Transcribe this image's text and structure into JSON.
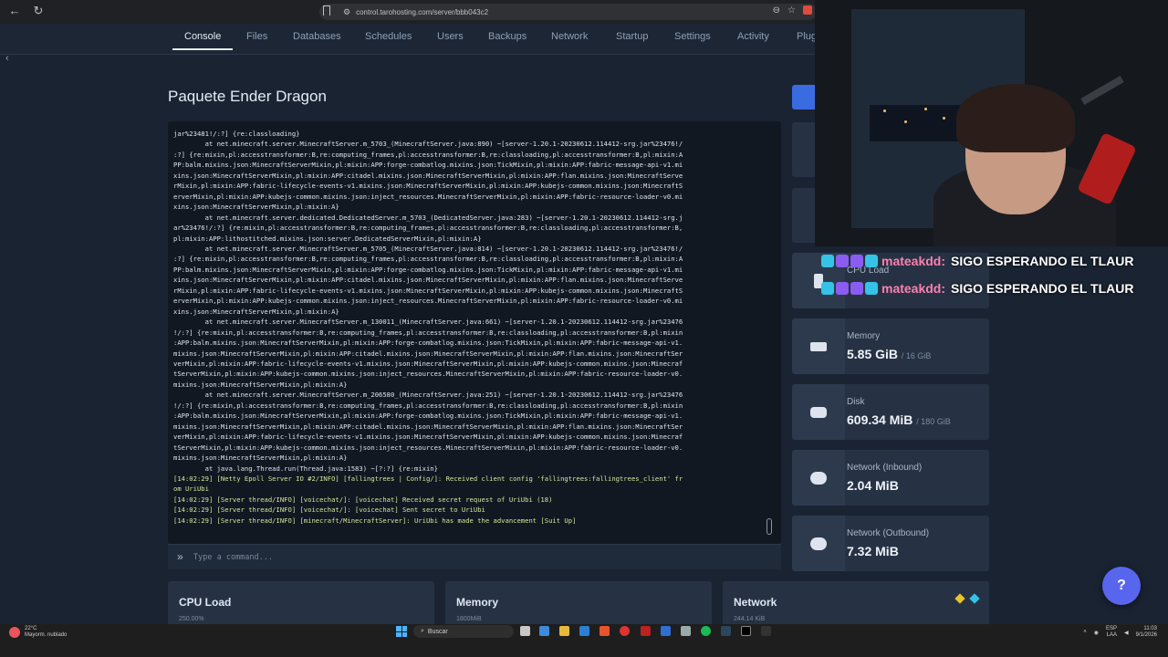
{
  "browser": {
    "url": "control.tarohosting.com/server/bbb043c2",
    "back_icon": "arrow-left-icon",
    "reload_icon": "reload-icon"
  },
  "nav": {
    "tabs": [
      "Console",
      "Files",
      "Databases",
      "Schedules",
      "Users",
      "Backups",
      "Network",
      "Startup",
      "Settings",
      "Activity",
      "Plug"
    ],
    "active_tab": "Console"
  },
  "server": {
    "title": "Paquete Ender Dragon"
  },
  "console": {
    "lines": [
      {
        "text": "jar%23481!/:?] {re:classloading}",
        "kind": "trace"
      },
      {
        "text": "        at net.minecraft.server.MinecraftServer.m_5703_(MinecraftServer.java:890) ~[server-1.20.1-20230612.114412-srg.jar%23476!/",
        "kind": "trace"
      },
      {
        "text": ":?] {re:mixin,pl:accesstransformer:B,re:computing_frames,pl:accesstransformer:B,re:classloading,pl:accesstransformer:B,pl:mixin:A",
        "kind": "trace"
      },
      {
        "text": "PP:balm.mixins.json:MinecraftServerMixin,pl:mixin:APP:forge-combatlog.mixins.json:TickMixin,pl:mixin:APP:fabric-message-api-v1.mi",
        "kind": "trace"
      },
      {
        "text": "xins.json:MinecraftServerMixin,pl:mixin:APP:citadel.mixins.json:MinecraftServerMixin,pl:mixin:APP:flan.mixins.json:MinecraftServe",
        "kind": "trace"
      },
      {
        "text": "rMixin,pl:mixin:APP:fabric-lifecycle-events-v1.mixins.json:MinecraftServerMixin,pl:mixin:APP:kubejs-common.mixins.json:MinecraftS",
        "kind": "trace"
      },
      {
        "text": "erverMixin,pl:mixin:APP:kubejs-common.mixins.json:inject_resources.MinecraftServerMixin,pl:mixin:APP:fabric-resource-loader-v0.mi",
        "kind": "trace"
      },
      {
        "text": "xins.json:MinecraftServerMixin,pl:mixin:A}",
        "kind": "trace"
      },
      {
        "text": "        at net.minecraft.server.dedicated.DedicatedServer.m_5703_(DedicatedServer.java:283) ~[server-1.20.1-20230612.114412-srg.j",
        "kind": "trace"
      },
      {
        "text": "ar%23476!/:?] {re:mixin,pl:accesstransformer:B,re:computing_frames,pl:accesstransformer:B,re:classloading,pl:accesstransformer:B,",
        "kind": "trace"
      },
      {
        "text": "pl:mixin:APP:lithostitched.mixins.json:server.DedicatedServerMixin,pl:mixin:A}",
        "kind": "trace"
      },
      {
        "text": "        at net.minecraft.server.MinecraftServer.m_5705_(MinecraftServer.java:814) ~[server-1.20.1-20230612.114412-srg.jar%23476!/",
        "kind": "trace"
      },
      {
        "text": ":?] {re:mixin,pl:accesstransformer:B,re:computing_frames,pl:accesstransformer:B,re:classloading,pl:accesstransformer:B,pl:mixin:A",
        "kind": "trace"
      },
      {
        "text": "PP:balm.mixins.json:MinecraftServerMixin,pl:mixin:APP:forge-combatlog.mixins.json:TickMixin,pl:mixin:APP:fabric-message-api-v1.mi",
        "kind": "trace"
      },
      {
        "text": "xins.json:MinecraftServerMixin,pl:mixin:APP:citadel.mixins.json:MinecraftServerMixin,pl:mixin:APP:flan.mixins.json:MinecraftServe",
        "kind": "trace"
      },
      {
        "text": "rMixin,pl:mixin:APP:fabric-lifecycle-events-v1.mixins.json:MinecraftServerMixin,pl:mixin:APP:kubejs-common.mixins.json:MinecraftS",
        "kind": "trace"
      },
      {
        "text": "erverMixin,pl:mixin:APP:kubejs-common.mixins.json:inject_resources.MinecraftServerMixin,pl:mixin:APP:fabric-resource-loader-v0.mi",
        "kind": "trace"
      },
      {
        "text": "xins.json:MinecraftServerMixin,pl:mixin:A}",
        "kind": "trace"
      },
      {
        "text": "        at net.minecraft.server.MinecraftServer.m_130011_(MinecraftServer.java:661) ~[server-1.20.1-20230612.114412-srg.jar%23476",
        "kind": "trace"
      },
      {
        "text": "!/:?] {re:mixin,pl:accesstransformer:B,re:computing_frames,pl:accesstransformer:B,re:classloading,pl:accesstransformer:B,pl:mixin",
        "kind": "trace"
      },
      {
        "text": ":APP:balm.mixins.json:MinecraftServerMixin,pl:mixin:APP:forge-combatlog.mixins.json:TickMixin,pl:mixin:APP:fabric-message-api-v1.",
        "kind": "trace"
      },
      {
        "text": "mixins.json:MinecraftServerMixin,pl:mixin:APP:citadel.mixins.json:MinecraftServerMixin,pl:mixin:APP:flan.mixins.json:MinecraftSer",
        "kind": "trace"
      },
      {
        "text": "verMixin,pl:mixin:APP:fabric-lifecycle-events-v1.mixins.json:MinecraftServerMixin,pl:mixin:APP:kubejs-common.mixins.json:Minecraf",
        "kind": "trace"
      },
      {
        "text": "tServerMixin,pl:mixin:APP:kubejs-common.mixins.json:inject_resources.MinecraftServerMixin,pl:mixin:APP:fabric-resource-loader-v0.",
        "kind": "trace"
      },
      {
        "text": "mixins.json:MinecraftServerMixin,pl:mixin:A}",
        "kind": "trace"
      },
      {
        "text": "        at net.minecraft.server.MinecraftServer.m_206580_(MinecraftServer.java:251) ~[server-1.20.1-20230612.114412-srg.jar%23476",
        "kind": "trace"
      },
      {
        "text": "!/:?] {re:mixin,pl:accesstransformer:B,re:computing_frames,pl:accesstransformer:B,re:classloading,pl:accesstransformer:B,pl:mixin",
        "kind": "trace"
      },
      {
        "text": ":APP:balm.mixins.json:MinecraftServerMixin,pl:mixin:APP:forge-combatlog.mixins.json:TickMixin,pl:mixin:APP:fabric-message-api-v1.",
        "kind": "trace"
      },
      {
        "text": "mixins.json:MinecraftServerMixin,pl:mixin:APP:citadel.mixins.json:MinecraftServerMixin,pl:mixin:APP:flan.mixins.json:MinecraftSer",
        "kind": "trace"
      },
      {
        "text": "verMixin,pl:mixin:APP:fabric-lifecycle-events-v1.mixins.json:MinecraftServerMixin,pl:mixin:APP:kubejs-common.mixins.json:Minecraf",
        "kind": "trace"
      },
      {
        "text": "tServerMixin,pl:mixin:APP:kubejs-common.mixins.json:inject_resources.MinecraftServerMixin,pl:mixin:APP:fabric-resource-loader-v0.",
        "kind": "trace"
      },
      {
        "text": "mixins.json:MinecraftServerMixin,pl:mixin:A}",
        "kind": "trace"
      },
      {
        "text": "        at java.lang.Thread.run(Thread.java:1583) ~[?:?] {re:mixin}",
        "kind": "trace"
      },
      {
        "text": "[14:02:29] [Netty Epoll Server IO #2/INFO] [fallingtrees | Config/]: Received client config 'fallingtrees:fallingtrees_client' fr",
        "kind": "log"
      },
      {
        "text": "om UriUbi",
        "kind": "log"
      },
      {
        "text": "[14:02:29] [Server thread/INFO] [voicechat/]: [voicechat] Received secret request of UriUbi (18)",
        "kind": "log"
      },
      {
        "text": "[14:02:29] [Server thread/INFO] [voicechat/]: [voicechat] Sent secret to UriUbi",
        "kind": "log"
      },
      {
        "text": "[14:02:29] [Server thread/INFO] [minecraft/MinecraftServer]: UriUbi has made the advancement [Suit Up]",
        "kind": "log"
      }
    ],
    "command_placeholder": "Type a command..."
  },
  "stats": [
    {
      "name": "cpu",
      "label": "CPU Load",
      "value": "",
      "max": "",
      "icon": "cpu-icon"
    },
    {
      "name": "memory",
      "label": "Memory",
      "value": "5.85 GiB",
      "max": "/ 16 GiB",
      "icon": "memory-icon"
    },
    {
      "name": "disk",
      "label": "Disk",
      "value": "609.34 MiB",
      "max": "/ 180 GiB",
      "icon": "disk-icon"
    },
    {
      "name": "net-in",
      "label": "Network (Inbound)",
      "value": "2.04 MiB",
      "max": "",
      "icon": "cloud-download-icon"
    },
    {
      "name": "net-out",
      "label": "Network (Outbound)",
      "value": "7.32 MiB",
      "max": "",
      "icon": "cloud-upload-icon"
    }
  ],
  "graphs": {
    "cpu": {
      "title": "CPU Load",
      "sub": "250.00%"
    },
    "memory": {
      "title": "Memory",
      "sub": "1800MiB"
    },
    "network": {
      "title": "Network",
      "sub": "244.14 KiB",
      "legend_colors": [
        "#e8c32a",
        "#36c2e6"
      ]
    }
  },
  "help": {
    "label": "?"
  },
  "chat": [
    {
      "user": "mateakdd:",
      "text": "SIGO ESPERANDO EL TLAUR"
    },
    {
      "user": "mateakdd:",
      "text": "SIGO ESPERANDO EL TLAUR"
    }
  ],
  "taskbar": {
    "weather_temp": "22°C",
    "weather_desc": "Mayorm. nublado",
    "search": "Buscar",
    "lang1": "ESP",
    "lang2": "LAA",
    "time": "11:03",
    "date": "9/1/2026"
  },
  "colors": {
    "accent": "#5866ee",
    "panel": "#263244",
    "console_bg": "#111822",
    "log_line": "#d6e69a"
  }
}
